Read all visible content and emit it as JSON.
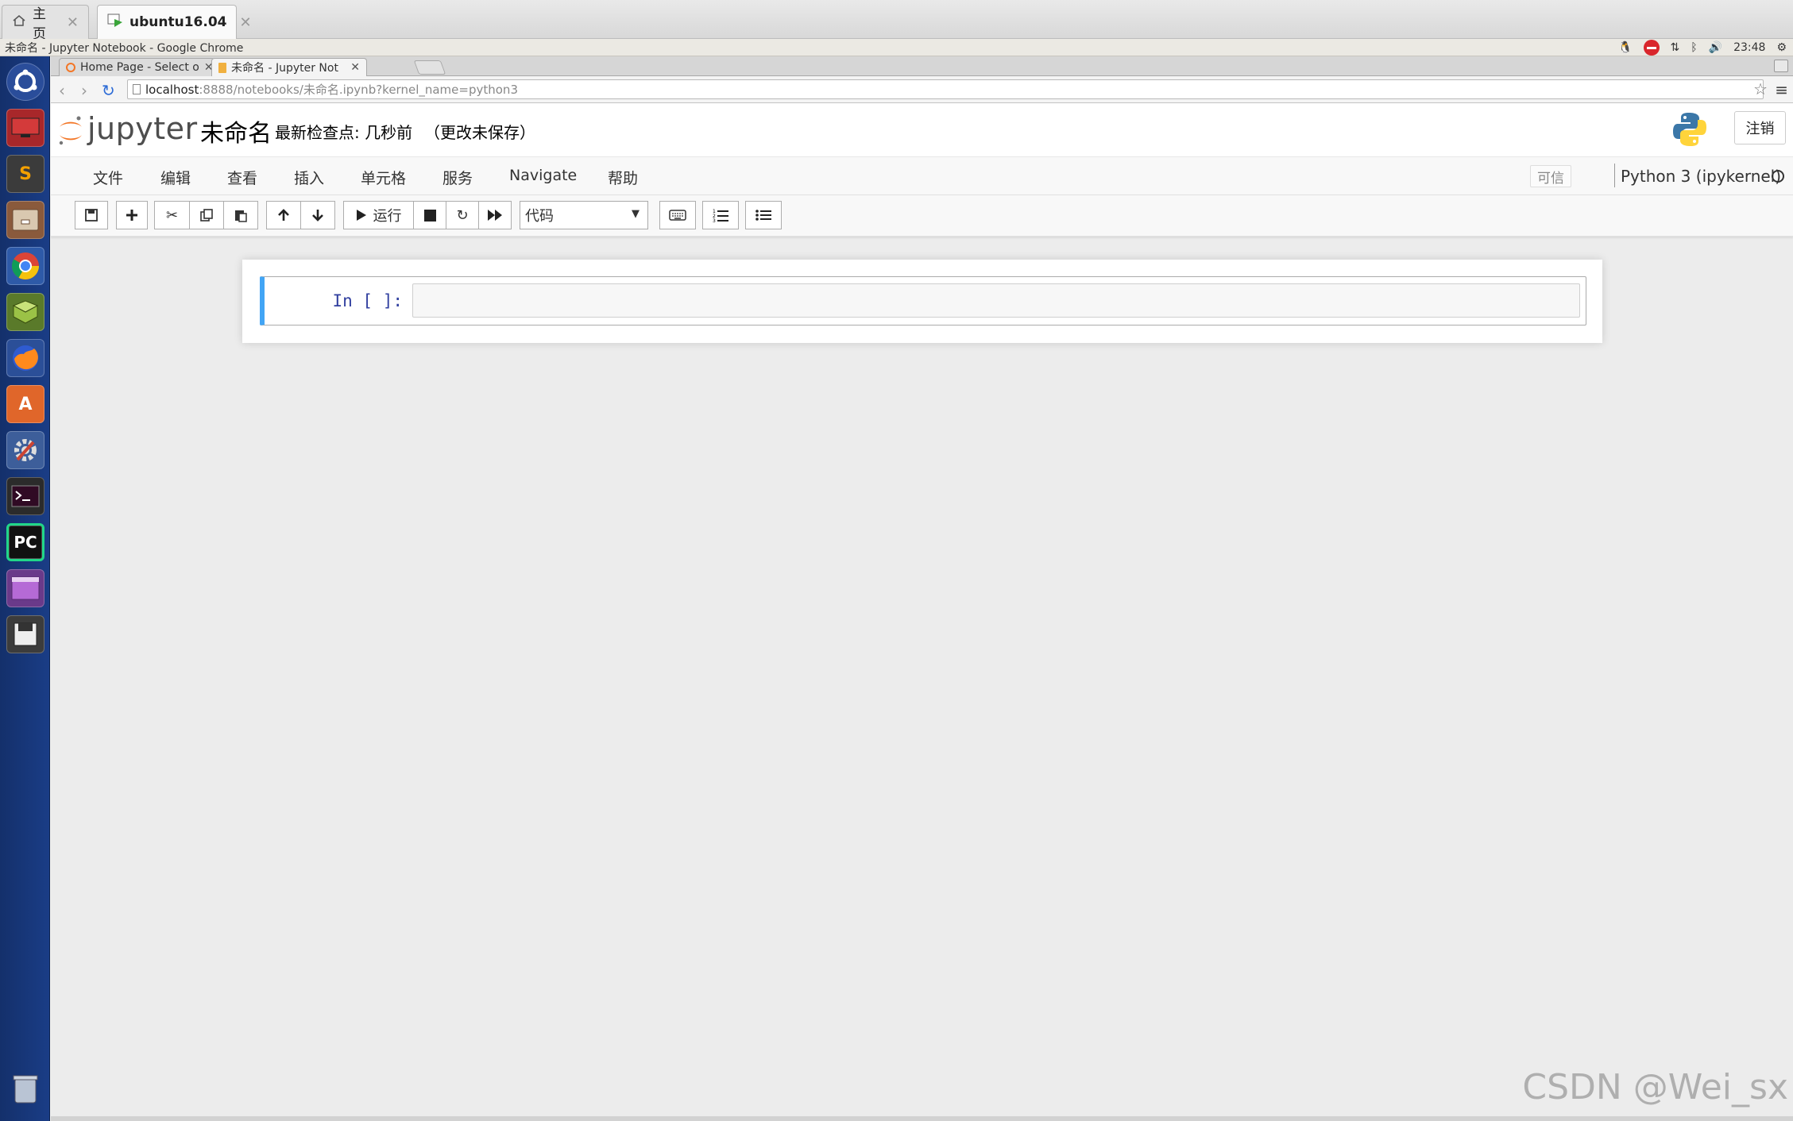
{
  "vm_tabs": [
    {
      "label": "主页",
      "icon": "home-icon"
    },
    {
      "label": "ubuntu16.04",
      "icon": "vm-icon"
    }
  ],
  "panel": {
    "window_title": "未命名 - Jupyter Notebook - Google Chrome",
    "clock": "23:48",
    "tray_icons": [
      "qq-icon",
      "stop-icon",
      "network-icon",
      "bluetooth-icon",
      "volume-icon",
      "settings-gear-icon"
    ]
  },
  "launcher": [
    "ubuntu-dash-icon",
    "remote-desktop-icon",
    "sublime-text-icon",
    "file-manager-icon",
    "chrome-icon",
    "book-icon",
    "firefox-icon",
    "software-center-icon",
    "system-settings-icon",
    "terminal-icon",
    "pycharm-icon",
    "workspace-icon",
    "save-disk-icon",
    "trash-icon"
  ],
  "chrome": {
    "tabs": [
      {
        "label": "Home Page - Select o"
      },
      {
        "label": "未命名 - Jupyter Not"
      }
    ],
    "url_host": "localhost",
    "url_rest": ":8888/notebooks/未命名.ipynb?kernel_name=python3"
  },
  "jupyter": {
    "logo_text": "jupyter",
    "notebook_name": "未命名",
    "checkpoint": "最新检查点: 几秒前",
    "autosave_status": "（更改未保存）",
    "logout": "注销",
    "menu": [
      "文件",
      "编辑",
      "查看",
      "插入",
      "单元格",
      "服务",
      "Navigate",
      "帮助"
    ],
    "trusted": "可信",
    "kernel": "Python 3 (ipykernel)",
    "run_label": "运行",
    "cell_type": "代码",
    "cell_prompt": "In [ ]:"
  },
  "watermark": "CSDN @Wei_sx"
}
